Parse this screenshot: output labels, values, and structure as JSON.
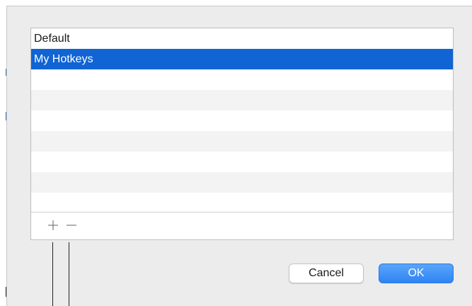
{
  "hotkey_sets": {
    "items": [
      {
        "label": "Default",
        "selected": false
      },
      {
        "label": "My Hotkeys",
        "selected": true
      },
      {
        "label": "",
        "selected": false
      },
      {
        "label": "",
        "selected": false
      },
      {
        "label": "",
        "selected": false
      },
      {
        "label": "",
        "selected": false
      },
      {
        "label": "",
        "selected": false
      },
      {
        "label": "",
        "selected": false
      },
      {
        "label": "",
        "selected": false
      }
    ],
    "add_icon": "plus-icon",
    "remove_icon": "minus-icon"
  },
  "buttons": {
    "cancel_label": "Cancel",
    "ok_label": "OK"
  },
  "colors": {
    "selection": "#1064d3",
    "ok_button": "#2f84f4",
    "dialog_background": "#ececec"
  }
}
